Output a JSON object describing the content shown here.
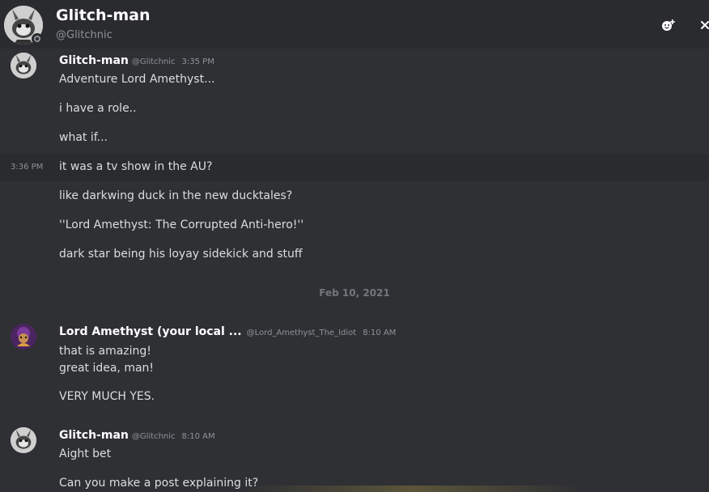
{
  "header": {
    "name": "Glitch-man",
    "handle": "@Glitchnic",
    "add_reaction_icon": "smiley-plus-icon",
    "close_icon": "close-icon",
    "avatar_icon": "avatar-icon"
  },
  "hover_timestamp": "3:36 PM",
  "date_divider": "Feb 10, 2021",
  "messages": [
    {
      "username": "Glitch-man",
      "handle": "@Glitchnic",
      "time": "3:35 PM",
      "lines": [
        "Adventure Lord Amethyst...",
        "i have a role..",
        "what if...",
        "it was a tv show in the AU?",
        "like darkwing duck in the new ducktales?",
        "''Lord Amethyst: The Corrupted Anti-hero!''",
        "dark star being his loyay sidekick and stuff"
      ]
    },
    {
      "username": "Lord Amethyst (your local ...",
      "handle": "@Lord_Amethyst_The_Idiot",
      "time": "8:10 AM",
      "lines": [
        "that is amazing!",
        "great idea, man!",
        "VERY MUCH YES."
      ]
    },
    {
      "username": "Glitch-man",
      "handle": "@Glitchnic",
      "time": "8:10 AM",
      "lines": [
        "Aight bet",
        "Can you make a post explaining it?"
      ]
    }
  ]
}
